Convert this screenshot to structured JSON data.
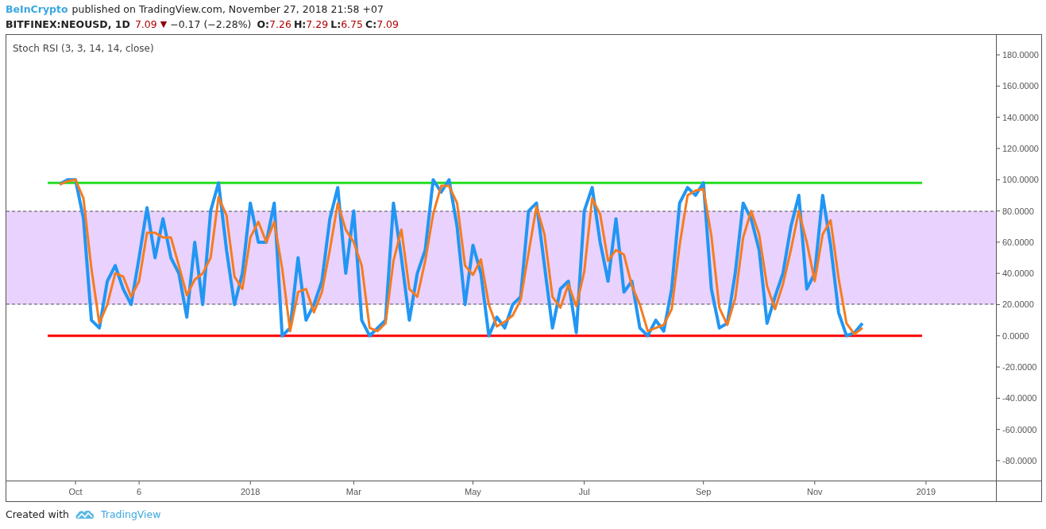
{
  "header": {
    "author": "BeInCrypto",
    "byline": "published on TradingView.com, November 27, 2018 21:58 +07"
  },
  "quote": {
    "symbol": "BITFINEX:NEOUSD, 1D",
    "last": "7.09",
    "arrow": "▼",
    "change": "−0.17 (−2.28%)",
    "ohlc": [
      {
        "label": "O:",
        "value": "7.26"
      },
      {
        "label": "H:",
        "value": "7.29"
      },
      {
        "label": "L:",
        "value": "6.75"
      },
      {
        "label": "C:",
        "value": "7.09"
      }
    ]
  },
  "chart": {
    "chart_data": {
      "type": "line",
      "title": "Stoch RSI (3, 3, 14, 14, close)",
      "categories": [
        null,
        null,
        "Oct",
        null,
        null,
        null,
        null,
        null,
        null,
        null,
        "6",
        null,
        null,
        null,
        null,
        null,
        null,
        null,
        null,
        null,
        null,
        null,
        null,
        null,
        "2018",
        null,
        null,
        null,
        null,
        null,
        null,
        null,
        null,
        null,
        null,
        null,
        null,
        "Mar",
        null,
        null,
        null,
        null,
        null,
        null,
        null,
        null,
        null,
        null,
        null,
        null,
        null,
        null,
        "May",
        null,
        null,
        null,
        null,
        null,
        null,
        null,
        null,
        null,
        null,
        null,
        null,
        null,
        "Jul",
        null,
        null,
        null,
        null,
        null,
        null,
        null,
        null,
        null,
        null,
        null,
        null,
        null,
        null,
        "Sep",
        null,
        null,
        null,
        null,
        null,
        null,
        null,
        null,
        null,
        null,
        null,
        null,
        null,
        "Nov",
        null,
        null,
        null,
        null,
        null,
        null,
        null,
        null,
        null,
        null,
        null,
        null,
        null,
        "2019"
      ],
      "series": [
        {
          "color": "#2196f3",
          "values": [
            97,
            100,
            100,
            75,
            10,
            5,
            35,
            45,
            30,
            20,
            50,
            82,
            50,
            75,
            50,
            40,
            12,
            60,
            20,
            80,
            98,
            55,
            20,
            40,
            85,
            60,
            60,
            85,
            0,
            5,
            50,
            10,
            20,
            35,
            75,
            95,
            40,
            80,
            10,
            0,
            5,
            10,
            85,
            50,
            10,
            40,
            55,
            100,
            92,
            100,
            70,
            20,
            58,
            40,
            0,
            12,
            5,
            20,
            25,
            80,
            85,
            45,
            5,
            30,
            35,
            2,
            80,
            95,
            60,
            35,
            75,
            28,
            35,
            5,
            0,
            10,
            3,
            30,
            85,
            95,
            90,
            98,
            30,
            5,
            8,
            40,
            85,
            75,
            55,
            8,
            25,
            40,
            70,
            90,
            30,
            40,
            90,
            58,
            15,
            0,
            2,
            8,
            null,
            null,
            null,
            null,
            null,
            null,
            null,
            null
          ]
        },
        {
          "color": "#f57c20",
          "values": [
            97,
            99,
            100,
            88,
            43,
            8,
            20,
            40,
            38,
            25,
            35,
            66,
            66,
            63,
            63,
            45,
            26,
            36,
            40,
            50,
            89,
            77,
            38,
            30,
            63,
            73,
            60,
            73,
            43,
            3,
            28,
            30,
            15,
            28,
            55,
            85,
            68,
            60,
            45,
            5,
            3,
            8,
            48,
            68,
            30,
            25,
            48,
            78,
            96,
            96,
            85,
            45,
            39,
            49,
            20,
            6,
            9,
            13,
            23,
            53,
            83,
            65,
            25,
            18,
            33,
            19,
            41,
            88,
            78,
            48,
            55,
            52,
            32,
            20,
            3,
            5,
            7,
            17,
            58,
            90,
            93,
            94,
            64,
            18,
            7,
            24,
            63,
            80,
            65,
            32,
            17,
            33,
            55,
            80,
            60,
            35,
            65,
            74,
            37,
            8,
            1,
            5,
            null,
            null,
            null,
            null,
            null,
            null,
            null,
            null
          ]
        }
      ],
      "ylim": [
        -92.75,
        192.75
      ],
      "yticks": [
        {
          "value": 180,
          "label": "180.0000"
        },
        {
          "value": 160,
          "label": "160.0000"
        },
        {
          "value": 140,
          "label": "140.0000"
        },
        {
          "value": 120,
          "label": "120.0000"
        },
        {
          "value": 100,
          "label": "100.0000"
        },
        {
          "value": 80,
          "label": "80.0000"
        },
        {
          "value": 60,
          "label": "60.0000"
        },
        {
          "value": 40,
          "label": "40.0000"
        },
        {
          "value": 20,
          "label": "20.0000"
        },
        {
          "value": 0,
          "label": "0.0000"
        },
        {
          "value": -20,
          "label": "-20.0000"
        },
        {
          "value": -40,
          "label": "-40.0000"
        },
        {
          "value": -60,
          "label": "-60.0000"
        },
        {
          "value": -80,
          "label": "-80.0000"
        }
      ],
      "bands": [
        {
          "axis": "y",
          "from": 20,
          "to": 80,
          "color": "#e9d2fd"
        }
      ],
      "ref_lines": [
        {
          "axis": "y",
          "value": 98,
          "color": "#22dd22"
        },
        {
          "axis": "y",
          "value": 0,
          "color": "#ff0000"
        }
      ]
    }
  },
  "footer": {
    "text": "Created with",
    "brand": "TradingView"
  }
}
